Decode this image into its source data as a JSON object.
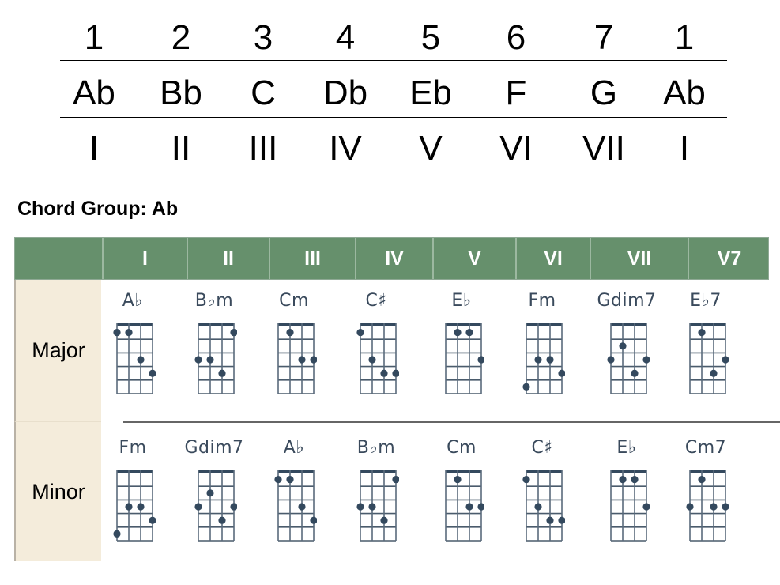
{
  "scale": {
    "degrees": [
      "1",
      "2",
      "3",
      "4",
      "5",
      "6",
      "7",
      "1"
    ],
    "notes": [
      "Ab",
      "Bb",
      "C",
      "Db",
      "Eb",
      "F",
      "G",
      "Ab"
    ],
    "numerals": [
      "I",
      "II",
      "III",
      "IV",
      "V",
      "VI",
      "VII",
      "I"
    ]
  },
  "group_title": "Chord Group: Ab",
  "table": {
    "header": [
      "",
      "I",
      "II",
      "III",
      "IV",
      "V",
      "VI",
      "VII",
      "V7"
    ],
    "header_color": "#66906c",
    "label_bg": "#f4ecdb",
    "dot_color": "#34495e",
    "rows": [
      {
        "label": "Major",
        "chords": [
          {
            "name": "A♭",
            "dots": [
              [
                0,
                1
              ],
              [
                1,
                1
              ],
              [
                2,
                3
              ],
              [
                3,
                4
              ]
            ]
          },
          {
            "name": "B♭m",
            "dots": [
              [
                3,
                1
              ],
              [
                0,
                3
              ],
              [
                1,
                3
              ],
              [
                2,
                4
              ]
            ]
          },
          {
            "name": "Cm",
            "dots": [
              [
                1,
                1
              ],
              [
                2,
                3
              ],
              [
                3,
                3
              ]
            ]
          },
          {
            "name": "C♯",
            "dots": [
              [
                0,
                1
              ],
              [
                1,
                3
              ],
              [
                2,
                4
              ],
              [
                3,
                4
              ]
            ]
          },
          {
            "name": "E♭",
            "dots": [
              [
                1,
                1
              ],
              [
                2,
                1
              ],
              [
                3,
                3
              ]
            ]
          },
          {
            "name": "Fm",
            "dots": [
              [
                1,
                3
              ],
              [
                2,
                3
              ],
              [
                3,
                4
              ],
              [
                0,
                5
              ]
            ]
          },
          {
            "name": "Gdim7",
            "dots": [
              [
                1,
                2
              ],
              [
                0,
                3
              ],
              [
                3,
                3
              ],
              [
                2,
                4
              ]
            ]
          },
          {
            "name": "E♭7",
            "dots": [
              [
                1,
                1
              ],
              [
                3,
                3
              ],
              [
                2,
                4
              ]
            ]
          }
        ]
      },
      {
        "label": "Minor",
        "chords": [
          {
            "name": "Fm",
            "dots": [
              [
                1,
                3
              ],
              [
                2,
                3
              ],
              [
                3,
                4
              ],
              [
                0,
                5
              ]
            ]
          },
          {
            "name": "Gdim7",
            "dots": [
              [
                1,
                2
              ],
              [
                0,
                3
              ],
              [
                3,
                3
              ],
              [
                2,
                4
              ]
            ]
          },
          {
            "name": "A♭",
            "dots": [
              [
                0,
                1
              ],
              [
                1,
                1
              ],
              [
                2,
                3
              ],
              [
                3,
                4
              ]
            ]
          },
          {
            "name": "B♭m",
            "dots": [
              [
                3,
                1
              ],
              [
                0,
                3
              ],
              [
                1,
                3
              ],
              [
                2,
                4
              ]
            ]
          },
          {
            "name": "Cm",
            "dots": [
              [
                1,
                1
              ],
              [
                2,
                3
              ],
              [
                3,
                3
              ]
            ]
          },
          {
            "name": "C♯",
            "dots": [
              [
                0,
                1
              ],
              [
                1,
                3
              ],
              [
                2,
                4
              ],
              [
                3,
                4
              ]
            ]
          },
          {
            "name": "E♭",
            "dots": [
              [
                1,
                1
              ],
              [
                2,
                1
              ],
              [
                3,
                3
              ]
            ]
          },
          {
            "name": "Cm7",
            "dots": [
              [
                1,
                1
              ],
              [
                0,
                3
              ],
              [
                2,
                3
              ],
              [
                3,
                3
              ]
            ]
          }
        ]
      }
    ]
  }
}
